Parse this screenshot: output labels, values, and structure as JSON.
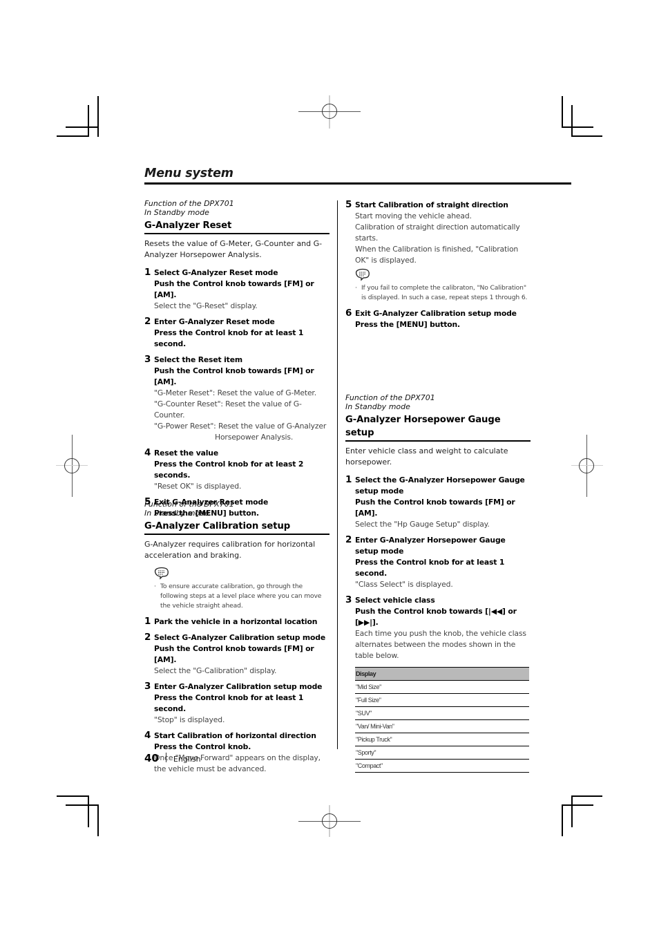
{
  "page": {
    "title": "Menu system",
    "footer": {
      "page_number": "40",
      "language": "English"
    }
  },
  "left_column": {
    "reset": {
      "function_note": [
        "Function of the DPX701",
        "In Standby mode"
      ],
      "title": "G-Analyzer Reset",
      "intro": "Resets the value of G-Meter, G-Counter and G-Analyzer Horsepower Analysis.",
      "steps": [
        {
          "num": "1",
          "head": "Select G-Analyzer Reset mode",
          "action": "Push the Control knob towards [FM] or [AM].",
          "notes": [
            "Select the \"G-Reset\" display."
          ]
        },
        {
          "num": "2",
          "head": "Enter G-Analyzer Reset mode",
          "action": "Press the Control knob for at least 1 second.",
          "notes": []
        },
        {
          "num": "3",
          "head": "Select the Reset item",
          "action": "Push the Control knob towards [FM] or [AM].",
          "notes": [
            "\"G-Meter Reset\": Reset the value of G-Meter.",
            "\"G-Counter Reset\": Reset the value of G-Counter.",
            "\"G-Power Reset\": Reset the value of G-Analyzer",
            "Horsepower Analysis."
          ]
        },
        {
          "num": "4",
          "head": "Reset the value",
          "action": "Press the Control knob for at least 2 seconds.",
          "notes": [
            "\"Reset OK\" is displayed."
          ]
        },
        {
          "num": "5",
          "head": "Exit G-Analyzer Reset mode",
          "action": "Press the [MENU] button.",
          "notes": []
        }
      ]
    },
    "calibration": {
      "function_note": [
        "Function of the DPX701",
        "In Standby mode"
      ],
      "title": "G-Analyzer Calibration setup",
      "intro": "G-Analyzer requires calibration for horizontal acceleration and braking.",
      "memo": {
        "icon": "memo-speech-bubble-icon",
        "text": "To ensure accurate calibration, go through the following steps at a level place where you can move the vehicle straight ahead."
      },
      "steps": [
        {
          "num": "1",
          "head": "Park the vehicle in a horizontal location",
          "action": "",
          "notes": []
        },
        {
          "num": "2",
          "head": "Select G-Analyzer Calibration setup mode",
          "action": "Push the Control knob towards [FM] or [AM].",
          "notes": [
            "Select the \"G-Calibration\" display."
          ]
        },
        {
          "num": "3",
          "head": "Enter G-Analyzer Calibration setup mode",
          "action": "Press the Control knob for at least 1 second.",
          "notes": [
            "\"Stop\" is displayed."
          ]
        },
        {
          "num": "4",
          "head": "Start Calibration of horizontal direction",
          "action": "Press the Control knob.",
          "notes": [
            "Once \"Move Forward\" appears on the display, the vehicle must be advanced."
          ]
        }
      ]
    }
  },
  "right_column": {
    "calibration_cont": {
      "steps": [
        {
          "num": "5",
          "head": "Start Calibration of straight direction",
          "notes": [
            "Start moving the vehicle ahead.",
            "Calibration of straight direction automatically starts.",
            "When the Calibration is finished, \"Calibration OK\" is displayed."
          ]
        },
        {
          "num": "6",
          "head": "Exit G-Analyzer Calibration setup mode",
          "action": "Press the [MENU] button."
        }
      ],
      "memo": {
        "icon": "memo-speech-bubble-icon",
        "text": "If you fail to complete the calibraton, \"No Calibration\" is displayed. In such a case, repeat steps 1 through 6."
      }
    },
    "hp_gauge": {
      "function_note": [
        "Function of the DPX701",
        "In Standby mode"
      ],
      "title": "G-Analyzer Horsepower Gauge setup",
      "intro": "Enter vehicle class and weight to calculate horsepower.",
      "steps": [
        {
          "num": "1",
          "head": "Select the G-Analyzer Horsepower Gauge setup mode",
          "action": "Push the Control knob towards [FM] or [AM].",
          "notes": [
            "Select the \"Hp Gauge Setup\" display."
          ]
        },
        {
          "num": "2",
          "head": "Enter G-Analyzer Horsepower Gauge setup mode",
          "action": "Press the Control knob for at least 1 second.",
          "notes": [
            "\"Class Select\" is displayed."
          ]
        },
        {
          "num": "3",
          "head": "Select vehicle class",
          "action": "Push the Control knob towards [|◀◀] or [▶▶|].",
          "notes": [
            "Each time you push the knob, the vehicle class alternates between the modes shown in the table below."
          ]
        }
      ],
      "table": {
        "header": "Display",
        "rows": [
          "\"Mid Size\"",
          "\"Full Size\"",
          "\"SUV\"",
          "\"Van/ Mini-Van\"",
          "\"Pickup Truck\"",
          "\"Sporty\"",
          "\"Compact\""
        ]
      }
    }
  }
}
